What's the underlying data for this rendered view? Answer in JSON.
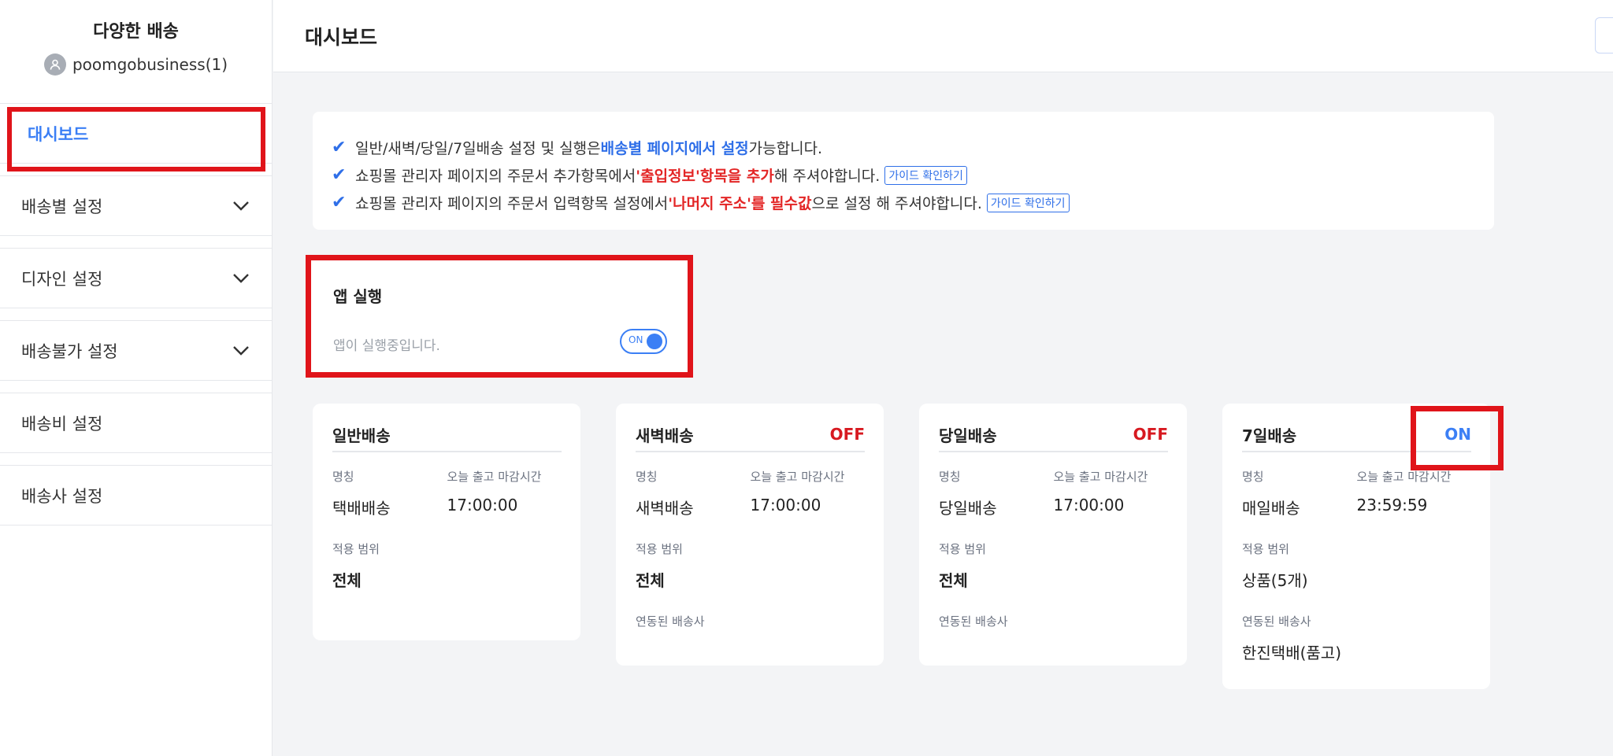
{
  "sidebar": {
    "store_name": "다양한 배송",
    "user": "poomgobusiness(1)",
    "items": [
      {
        "label": "대시보드"
      },
      {
        "label": "배송별 설정"
      },
      {
        "label": "디자인 설정"
      },
      {
        "label": "배송불가 설정"
      },
      {
        "label": "배송비 설정"
      },
      {
        "label": "배송사 설정"
      }
    ]
  },
  "header": {
    "title": "대시보드"
  },
  "notice": {
    "line1": {
      "prefix": "일반/새벽/당일/7일배송 설정 및 실행은 ",
      "highlight": "배송별 페이지에서 설정",
      "suffix": " 가능합니다."
    },
    "line2": {
      "prefix": "쇼핑몰 관리자 페이지의 주문서 추가항목에서 ",
      "highlight": "'출입정보'항목을 추가",
      "suffix": " 해 주셔야합니다.",
      "button": "가이드 확인하기"
    },
    "line3": {
      "prefix": "쇼핑몰 관리자 페이지의 주문서 입력항목 설정에서 ",
      "highlight": "'나머지 주소'를 필수값",
      "suffix": "으로 설정 해 주셔야합니다.",
      "button": "가이드 확인하기"
    }
  },
  "app_run": {
    "title": "앱 실행",
    "status_text": "앱이 실행중입니다.",
    "toggle_label": "ON",
    "enabled": true
  },
  "cards": [
    {
      "title": "일반배송",
      "status": "",
      "name_label": "명칭",
      "name": "택배배송",
      "cutoff_label": "오늘 출고 마감시간",
      "cutoff": "17:00:00",
      "scope_label": "적용 범위",
      "scope": "전체",
      "carrier_label": "",
      "carrier": ""
    },
    {
      "title": "새벽배송",
      "status": "OFF",
      "name_label": "명칭",
      "name": "새벽배송",
      "cutoff_label": "오늘 출고 마감시간",
      "cutoff": "17:00:00",
      "scope_label": "적용 범위",
      "scope": "전체",
      "carrier_label": "연동된 배송사",
      "carrier": ""
    },
    {
      "title": "당일배송",
      "status": "OFF",
      "name_label": "명칭",
      "name": "당일배송",
      "cutoff_label": "오늘 출고 마감시간",
      "cutoff": "17:00:00",
      "scope_label": "적용 범위",
      "scope": "전체",
      "carrier_label": "연동된 배송사",
      "carrier": ""
    },
    {
      "title": "7일배송",
      "status": "ON",
      "name_label": "명칭",
      "name": "매일배송",
      "cutoff_label": "오늘 출고 마감시간",
      "cutoff": "23:59:59",
      "scope_label": "적용 범위",
      "scope": "상품(5개)",
      "carrier_label": "연동된 배송사",
      "carrier": "한진택배(품고)"
    }
  ],
  "colors": {
    "accent": "#3b7ff5",
    "off": "#d71920",
    "highlight_box": "#e0141a"
  },
  "icons": {
    "avatar": "user-icon",
    "chevron": "chevron-down-icon",
    "check": "check-icon"
  }
}
